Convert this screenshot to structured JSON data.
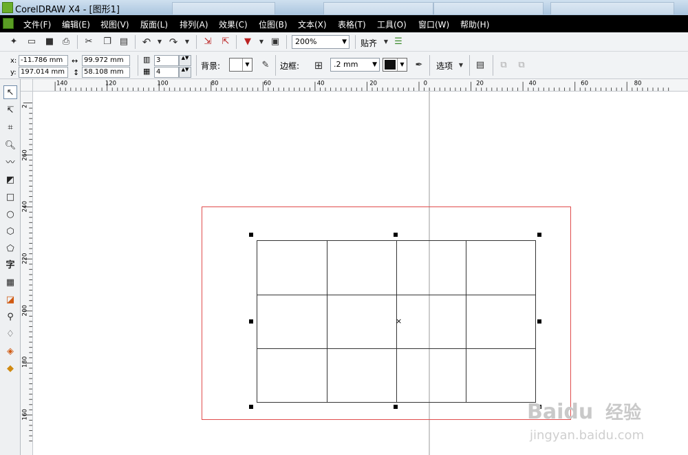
{
  "window": {
    "title": "CorelDRAW X4 - [图形1]"
  },
  "menu": [
    {
      "label": "文件(F)"
    },
    {
      "label": "编辑(E)"
    },
    {
      "label": "视图(V)"
    },
    {
      "label": "版面(L)"
    },
    {
      "label": "排列(A)"
    },
    {
      "label": "效果(C)"
    },
    {
      "label": "位图(B)"
    },
    {
      "label": "文本(X)"
    },
    {
      "label": "表格(T)"
    },
    {
      "label": "工具(O)"
    },
    {
      "label": "窗口(W)"
    },
    {
      "label": "帮助(H)"
    }
  ],
  "toolbar": {
    "zoom": "200%",
    "snap_label": "贴齐"
  },
  "properties": {
    "x_label": "x:",
    "x_value": "-11.786 mm",
    "y_label": "y:",
    "y_value": "197.014 mm",
    "width_value": "99.972 mm",
    "height_value": "58.108 mm",
    "rows_value": "3",
    "cols_value": "4",
    "background_label": "背景:",
    "border_label": "边框:",
    "border_width": ".2 mm",
    "border_color": "#111111",
    "options_label": "选项"
  },
  "toolbox": {
    "tools": [
      {
        "icon": "pick-tool-icon"
      },
      {
        "icon": "shape-tool-icon"
      },
      {
        "icon": "crop-tool-icon"
      },
      {
        "icon": "zoom-tool-icon"
      },
      {
        "icon": "freehand-tool-icon"
      },
      {
        "icon": "smart-fill-tool-icon"
      },
      {
        "icon": "rectangle-tool-icon"
      },
      {
        "icon": "ellipse-tool-icon"
      },
      {
        "icon": "polygon-tool-icon"
      },
      {
        "icon": "basic-shapes-tool-icon"
      },
      {
        "icon": "text-tool-icon",
        "label": "字"
      },
      {
        "icon": "table-tool-icon"
      },
      {
        "icon": "interactive-tool-icon"
      },
      {
        "icon": "eyedropper-tool-icon"
      },
      {
        "icon": "outline-tool-icon"
      },
      {
        "icon": "fill-tool-icon"
      },
      {
        "icon": "interactive-fill-tool-icon"
      }
    ]
  },
  "rulers": {
    "horizontal_labels": [
      "140",
      "120",
      "100",
      "80",
      "60",
      "40",
      "20",
      "0",
      "20",
      "40",
      "60",
      "80"
    ],
    "vertical_labels": [
      "2",
      "260",
      "240",
      "220",
      "200",
      "180",
      "160"
    ]
  },
  "table": {
    "rows": 3,
    "cols": 4
  },
  "colors": {
    "menubar": "#000000",
    "page_border": "#e04b4b",
    "table_line": "#333333"
  },
  "watermark": {
    "brand": "Baidu",
    "brand_cn": "经验",
    "url": "jingyan.baidu.com"
  }
}
